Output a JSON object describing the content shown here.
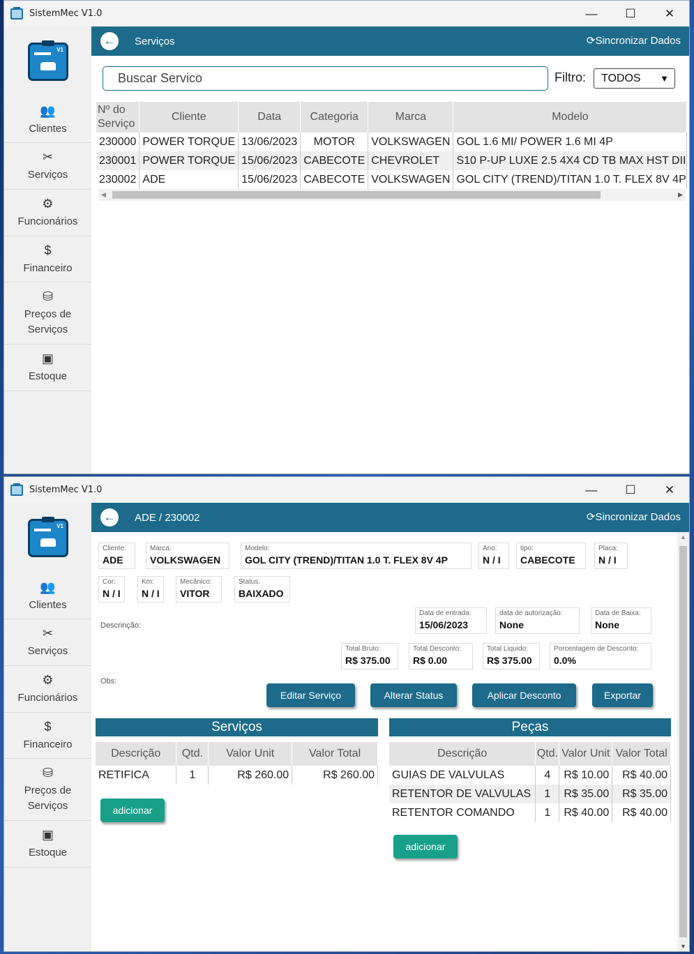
{
  "app": {
    "title": "SistemMec V1.0",
    "logo_badge": "V1"
  },
  "window_controls": {
    "minimize": "—",
    "maximize": "☐",
    "close": "✕"
  },
  "sidebar": {
    "items": [
      {
        "label": "Clientes",
        "icon": "users-icon"
      },
      {
        "label": "Serviços",
        "icon": "tools-icon"
      },
      {
        "label": "Funcionários",
        "icon": "user-gear-icon"
      },
      {
        "label": "Financeiro",
        "icon": "dollar-icon"
      },
      {
        "label": "Preços de Serviços",
        "icon": "price-tag-icon"
      },
      {
        "label": "Estoque",
        "icon": "box-icon"
      }
    ]
  },
  "list_screen": {
    "header_title": "Serviços",
    "sync_label": "Sincronizar Dados",
    "search_placeholder": "Buscar Servico",
    "filter_label": "Filtro:",
    "filter_value": "TODOS",
    "columns": [
      "Nº do Serviço",
      "Cliente",
      "Data",
      "Categoria",
      "Marca",
      "Modelo"
    ],
    "rows": [
      [
        "230000",
        "POWER TORQUE",
        "13/06/2023",
        "MOTOR",
        "VOLKSWAGEN",
        "GOL 1.6 MI/ POWER 1.6 MI 4P"
      ],
      [
        "230001",
        "POWER TORQUE",
        "15/06/2023",
        "CABECOTE",
        "CHEVROLET",
        "S10 P-UP LUXE 2.5 4X4 CD TB MAX HST DII"
      ],
      [
        "230002",
        "ADE",
        "15/06/2023",
        "CABECOTE",
        "VOLKSWAGEN",
        "GOL CITY (TREND)/TITAN 1.0 T. FLEX 8V 4P"
      ]
    ]
  },
  "detail_screen": {
    "header_title": "ADE / 230002",
    "sync_label": "Sincronizar Dados",
    "fields": {
      "cliente": {
        "label": "Cliente:",
        "value": "ADE"
      },
      "marca": {
        "label": "Marca:",
        "value": "VOLKSWAGEN"
      },
      "modelo": {
        "label": "Modelo:",
        "value": "GOL CITY (TREND)/TITAN 1.0 T. FLEX 8V 4P"
      },
      "ano": {
        "label": "Ano:",
        "value": "N / I"
      },
      "tipo": {
        "label": "tipo:",
        "value": "CABECOTE"
      },
      "placa": {
        "label": "Placa:",
        "value": "N / I"
      },
      "cor": {
        "label": "Cor:",
        "value": "N / I"
      },
      "km": {
        "label": "Km:",
        "value": "N / I"
      },
      "mecanico": {
        "label": "Mecânico:",
        "value": "VITOR"
      },
      "status": {
        "label": "Status:",
        "value": "BAIXADO"
      },
      "data_entrada": {
        "label": "Data de entrada:",
        "value": "15/06/2023"
      },
      "data_autorizacao": {
        "label": "data de autorização:",
        "value": "None"
      },
      "data_baixa": {
        "label": "Data de Baixa:",
        "value": "None"
      },
      "total_bruto": {
        "label": "Total Bruto:",
        "value": "R$ 375.00"
      },
      "total_desconto": {
        "label": "Total Desconto:",
        "value": "R$ 0.00"
      },
      "total_liquido": {
        "label": "Total Liquido:",
        "value": "R$ 375.00"
      },
      "porcentagem_desconto": {
        "label": "Porcentagem de Desconto:",
        "value": "0.0%"
      }
    },
    "descricao_label": "Descrinção:",
    "obs_label": "Obs:",
    "buttons": {
      "editar": "Editar Serviço",
      "alterar_status": "Alterar Status",
      "aplicar_desconto": "Aplicar Desconto",
      "exportar": "Exportar"
    },
    "servicos": {
      "title": "Serviços",
      "columns": [
        "Descrição",
        "Qtd.",
        "Valor Unit",
        "Valor Total"
      ],
      "rows": [
        [
          "RETIFICA",
          "1",
          "R$ 260.00",
          "R$ 260.00"
        ]
      ],
      "add_label": "adicionar"
    },
    "pecas": {
      "title": "Peças",
      "columns": [
        "Descrição",
        "Qtd.",
        "Valor Unit",
        "Valor Total"
      ],
      "rows": [
        [
          "GUIAS DE VALVULAS",
          "4",
          "R$ 10.00",
          "R$ 40.00"
        ],
        [
          "RETENTOR DE VALVULAS",
          "1",
          "R$ 35.00",
          "R$ 35.00"
        ],
        [
          "RETENTOR COMANDO",
          "1",
          "R$ 40.00",
          "R$ 40.00"
        ]
      ],
      "add_label": "adicionar"
    }
  },
  "colors": {
    "primary": "#1d6a8a",
    "accent_green": "#18a08a",
    "sidebar_bg": "#f0f0f0"
  }
}
